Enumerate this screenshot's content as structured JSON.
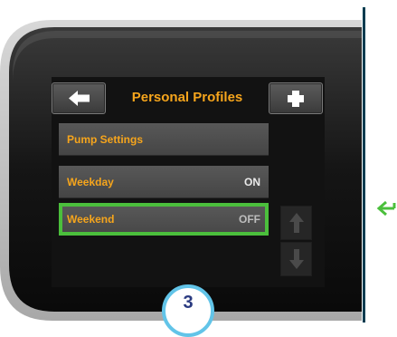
{
  "header": {
    "title": "Personal Profiles",
    "back_icon": "arrow-left-icon",
    "add_icon": "plus-icon"
  },
  "rows": [
    {
      "label": "Pump Settings",
      "value": ""
    },
    {
      "label": "Weekday",
      "value": "ON"
    },
    {
      "label": "Weekend",
      "value": "OFF"
    }
  ],
  "scroll": {
    "up_icon": "arrow-up-icon",
    "down_icon": "arrow-down-icon"
  },
  "step_badge": "3",
  "colors": {
    "accent": "#f6a51c",
    "highlight": "#4bbf3c",
    "badge_border": "#62c4e8",
    "badge_text": "#2a3a80",
    "divider": "#003c50"
  }
}
